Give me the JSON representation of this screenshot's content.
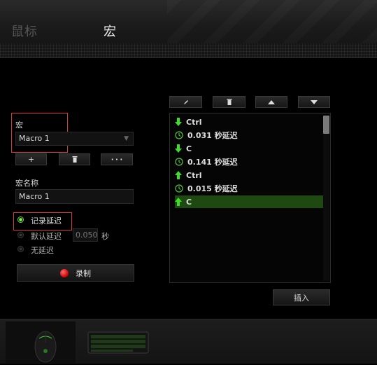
{
  "header": {
    "tabs": [
      {
        "label": "鼠标",
        "active": false
      },
      {
        "label": "宏",
        "active": true
      }
    ]
  },
  "macro": {
    "select_label": "宏",
    "selected_macro": "Macro 1",
    "add_label": "+",
    "delete_icon": "trash-icon",
    "more_label": "• • •",
    "name_label": "宏名称",
    "name_value": "Macro 1"
  },
  "delay": {
    "record_delay_label": "记录延迟",
    "default_delay_label": "默认延迟",
    "default_delay_value": "0.050",
    "seconds_unit": "秒",
    "no_delay_label": "无延迟",
    "selected": "record"
  },
  "record_button": {
    "label": "录制"
  },
  "toolbar": {
    "icons": [
      "pencil-icon",
      "trash-icon",
      "triangle-up-icon",
      "triangle-down-icon"
    ]
  },
  "events": [
    {
      "type": "key-down",
      "text": "Ctrl"
    },
    {
      "type": "delay",
      "text": "0.031 秒延迟"
    },
    {
      "type": "key-down",
      "text": "C"
    },
    {
      "type": "delay",
      "text": "0.141 秒延迟"
    },
    {
      "type": "key-up",
      "text": "Ctrl"
    },
    {
      "type": "delay",
      "text": "0.015 秒延迟"
    },
    {
      "type": "key-up",
      "text": "C",
      "selected": true
    }
  ],
  "insert_button": {
    "label": "插入"
  },
  "colors": {
    "accent_green": "#6fcf3d",
    "selected_row": "#1e4a12",
    "highlight_red": "#d93a3a",
    "record_red": "#c80000"
  },
  "devices": [
    "mouse-device-icon",
    "keyboard-device-icon"
  ]
}
